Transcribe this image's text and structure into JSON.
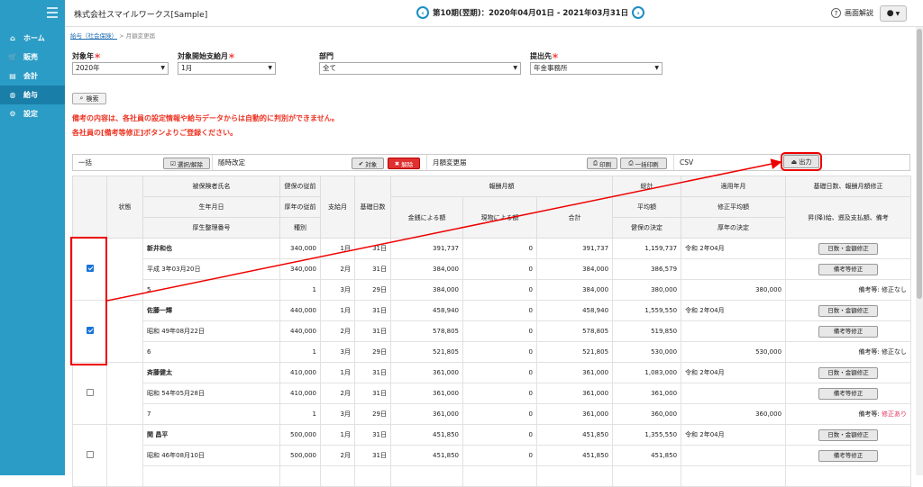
{
  "sidebar": {
    "items": [
      {
        "label": "ホーム",
        "icon": "home-icon"
      },
      {
        "label": "販売",
        "icon": "cart-icon"
      },
      {
        "label": "会計",
        "icon": "ledger-icon"
      },
      {
        "label": "給与",
        "icon": "money-bag-icon"
      },
      {
        "label": "設定",
        "icon": "gear-icon"
      }
    ]
  },
  "header": {
    "company": "株式会社スマイルワークス[Sample]",
    "period": "第10期(翌期)：2020年04月01日 - 2021年03月31日",
    "help": "画面解説"
  },
  "breadcrumb": {
    "link": "給与（社会保険）",
    "sep": ">",
    "current": "月額変更届"
  },
  "filters": {
    "year_label": "対象年",
    "year_value": "2020年",
    "month_label": "対象開始支給月",
    "month_value": "1月",
    "dept_label": "部門",
    "dept_value": "全て",
    "dest_label": "提出先",
    "dest_value": "年金事務所",
    "req": "＊"
  },
  "search_label": "検索",
  "notice": {
    "line1": "備考の内容は、各社員の設定情報や給与データからは自動的に判別ができません。",
    "line2": "各社員の[備考等修正]ボタンよりご登録ください。"
  },
  "toolbar": {
    "bulk": "一括",
    "select_release": "選択/解除",
    "revision": "随時改定",
    "target": "対象",
    "release": "解除",
    "form_name": "月額変更届",
    "print": "印刷",
    "bulk_print": "一括印刷",
    "csv": "CSV",
    "output": "出力"
  },
  "table": {
    "h_status": "状態",
    "h_name": "被保険者氏名",
    "h_dob": "生年月日",
    "h_pension_no": "厚生整理番号",
    "h_hi_prev": "健保の従前",
    "h_pi_prev": "厚年の従前",
    "h_type": "種別",
    "h_pay_month": "支給月",
    "h_base_days": "基礎日数",
    "h_reward": "報酬月額",
    "h_cash": "金銭による額",
    "h_goods": "現物による額",
    "h_total": "合計",
    "h_sum": "総計",
    "h_avg": "平均額",
    "h_hi_decide": "健保の決定",
    "h_apply": "適用年月",
    "h_corr_avg": "修正平均額",
    "h_pi_decide": "厚年の決定",
    "h_fix": "基礎日数、報酬月額修正",
    "h_note": "昇(降)給、遡及支払額、備考",
    "btn_days_fix": "日数・金額修正",
    "btn_note_fix": "備考等修正",
    "note_prefix": "備考等: "
  },
  "employees": [
    {
      "checked": true,
      "name": "新井和也",
      "dob": "平成 3年03月20日",
      "no": "5",
      "hi_prev": "340,000",
      "pi_prev": "340,000",
      "type": "1",
      "rows": [
        {
          "m": "1月",
          "d": "31日",
          "cash": "391,737",
          "goods": "0",
          "total": "391,737"
        },
        {
          "m": "2月",
          "d": "31日",
          "cash": "384,000",
          "goods": "0",
          "total": "384,000"
        },
        {
          "m": "3月",
          "d": "29日",
          "cash": "384,000",
          "goods": "0",
          "total": "384,000"
        }
      ],
      "sum": "1,159,737",
      "avg": "386,579",
      "hi_dec": "380,000",
      "apply": "令和 2年04月",
      "corr_avg": "",
      "pi_dec": "380,000",
      "note": "修正なし",
      "note_flag": false
    },
    {
      "checked": true,
      "name": "佐藤一輝",
      "dob": "昭和 49年08月22日",
      "no": "6",
      "hi_prev": "440,000",
      "pi_prev": "440,000",
      "type": "1",
      "rows": [
        {
          "m": "1月",
          "d": "31日",
          "cash": "458,940",
          "goods": "0",
          "total": "458,940"
        },
        {
          "m": "2月",
          "d": "31日",
          "cash": "578,805",
          "goods": "0",
          "total": "578,805"
        },
        {
          "m": "3月",
          "d": "29日",
          "cash": "521,805",
          "goods": "0",
          "total": "521,805"
        }
      ],
      "sum": "1,559,550",
      "avg": "519,850",
      "hi_dec": "530,000",
      "apply": "令和 2年04月",
      "corr_avg": "",
      "pi_dec": "530,000",
      "note": "修正なし",
      "note_flag": false
    },
    {
      "checked": false,
      "name": "斉藤健太",
      "dob": "昭和 54年05月28日",
      "no": "7",
      "hi_prev": "410,000",
      "pi_prev": "410,000",
      "type": "1",
      "rows": [
        {
          "m": "1月",
          "d": "31日",
          "cash": "361,000",
          "goods": "0",
          "total": "361,000"
        },
        {
          "m": "2月",
          "d": "31日",
          "cash": "361,000",
          "goods": "0",
          "total": "361,000"
        },
        {
          "m": "3月",
          "d": "29日",
          "cash": "361,000",
          "goods": "0",
          "total": "361,000"
        }
      ],
      "sum": "1,083,000",
      "avg": "361,000",
      "hi_dec": "360,000",
      "apply": "令和 2年04月",
      "corr_avg": "",
      "pi_dec": "360,000",
      "note": "修正あり",
      "note_flag": true
    },
    {
      "checked": false,
      "name": "関 昌平",
      "dob": "昭和 46年08月10日",
      "no": "",
      "hi_prev": "500,000",
      "pi_prev": "500,000",
      "type": "",
      "rows": [
        {
          "m": "1月",
          "d": "31日",
          "cash": "451,850",
          "goods": "0",
          "total": "451,850"
        },
        {
          "m": "2月",
          "d": "31日",
          "cash": "451,850",
          "goods": "0",
          "total": "451,850"
        }
      ],
      "sum": "1,355,550",
      "avg": "451,850",
      "hi_dec": "",
      "apply": "令和 2年04月",
      "corr_avg": "",
      "pi_dec": "",
      "note": "",
      "note_flag": false
    }
  ]
}
